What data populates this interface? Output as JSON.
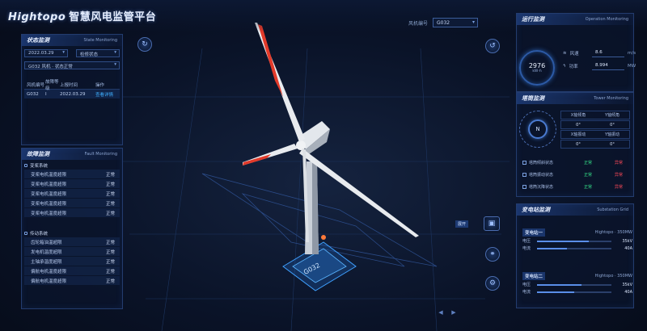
{
  "header": {
    "brand": "Hightopo",
    "title_cn": "智慧风电监管平台",
    "turbine_label": "风机编号",
    "turbine_value": "G032"
  },
  "left": {
    "status": {
      "title": "状态监测",
      "title_en": "State Monitoring",
      "date": "2022.03.29",
      "mode": "检修状态",
      "device": "G032 风机 · 状态正常",
      "headers": [
        "风机编号",
        "故障等级",
        "上报时间",
        "操作"
      ],
      "rows": [
        {
          "id": "G032",
          "level": "I",
          "time": "2022.03.29",
          "action": "查看详情"
        }
      ]
    },
    "fault": {
      "title": "故障监测",
      "title_en": "Fault Monitoring",
      "groups": [
        {
          "name": "变桨系统",
          "items": [
            {
              "label": "变桨电机温度超限",
              "value": "正常"
            },
            {
              "label": "变桨电机温度超限",
              "value": "正常"
            },
            {
              "label": "变桨电机温度超限",
              "value": "正常"
            },
            {
              "label": "变桨电机温度超限",
              "value": "正常"
            },
            {
              "label": "变桨电机温度超限",
              "value": "正常"
            }
          ]
        },
        {
          "name": "传动系统",
          "items": [
            {
              "label": "齿轮箱油温超限",
              "value": "正常"
            },
            {
              "label": "发电机温度超限",
              "value": "正常"
            },
            {
              "label": "主轴承温度超限",
              "value": "正常"
            },
            {
              "label": "偏航电机温度超限",
              "value": "正常"
            },
            {
              "label": "偏航电机温度超限",
              "value": "正常"
            }
          ]
        }
      ]
    }
  },
  "right": {
    "op": {
      "title": "运行监测",
      "title_en": "Operation Monitoring",
      "gauge_value": "2976",
      "gauge_unit": "kW·h",
      "metrics": [
        {
          "label": "风速",
          "value": "8.6",
          "unit": "m/s"
        },
        {
          "label": "功率",
          "value": "8.994",
          "unit": "MW"
        }
      ]
    },
    "tower": {
      "title": "塔筒监测",
      "title_en": "Tower Monitoring",
      "compass": "N",
      "headers": [
        "X轴倾角",
        "Y轴倾角"
      ],
      "values": [
        "0°",
        "0°"
      ],
      "headers2": [
        "X轴振动",
        "Y轴振动"
      ],
      "values2": [
        "0°",
        "0°"
      ],
      "states": [
        {
          "label": "塔筒倾斜状态",
          "s1": "正常",
          "s2": "异常"
        },
        {
          "label": "塔筒振动状态",
          "s1": "正常",
          "s2": "异常"
        },
        {
          "label": "塔筒沉降状态",
          "s1": "正常",
          "s2": "异常"
        }
      ]
    },
    "substation": {
      "title": "变电站监测",
      "title_en": "Substation Grid",
      "units": [
        {
          "tag": "变电站一",
          "name": "Hightopo · 350MW",
          "bars": [
            {
              "label": "电压",
              "value": "35kV",
              "fill": 0.7
            },
            {
              "label": "电流",
              "value": "40A",
              "fill": 0.4
            }
          ]
        },
        {
          "tag": "变电站二",
          "name": "Hightopo · 350MW",
          "bars": [
            {
              "label": "电压",
              "value": "35kV",
              "fill": 0.6
            },
            {
              "label": "电流",
              "value": "40A",
              "fill": 0.5
            }
          ]
        }
      ]
    }
  },
  "actions": {
    "expand_label": "展开"
  }
}
